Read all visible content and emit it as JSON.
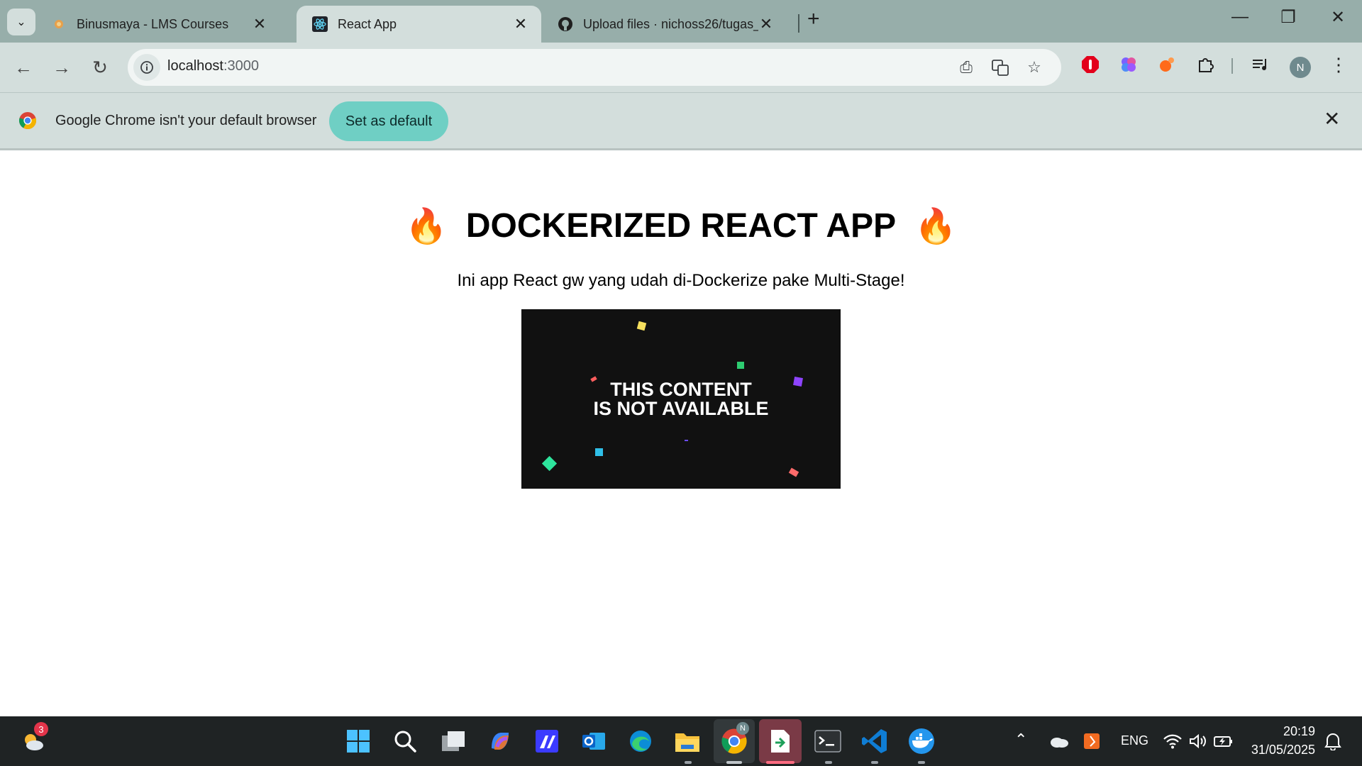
{
  "browser": {
    "tabs": [
      {
        "title": "Binusmaya - LMS Courses",
        "favicon": "binusmaya-icon",
        "active": false
      },
      {
        "title": "React App",
        "favicon": "react-icon",
        "active": true
      },
      {
        "title": "Upload files · nichoss26/tugas_c",
        "favicon": "github-icon",
        "active": false
      }
    ],
    "address": {
      "host": "localhost",
      "port": ":3000"
    }
  },
  "infobar": {
    "message": "Google Chrome isn't your default browser",
    "button_label": "Set as default"
  },
  "page": {
    "heading": "DOCKERIZED REACT APP",
    "heading_emoji": "🔥",
    "subtitle": "Ini app React gw yang udah di-Dockerize pake Multi-Stage!",
    "video_message_line1": "THIS CONTENT",
    "video_message_line2": "IS NOT AVAILABLE"
  },
  "profile": {
    "initial": "N"
  },
  "taskbar": {
    "weather_badge": "3",
    "language": "ENG",
    "time": "20:19",
    "date": "31/05/2025"
  }
}
